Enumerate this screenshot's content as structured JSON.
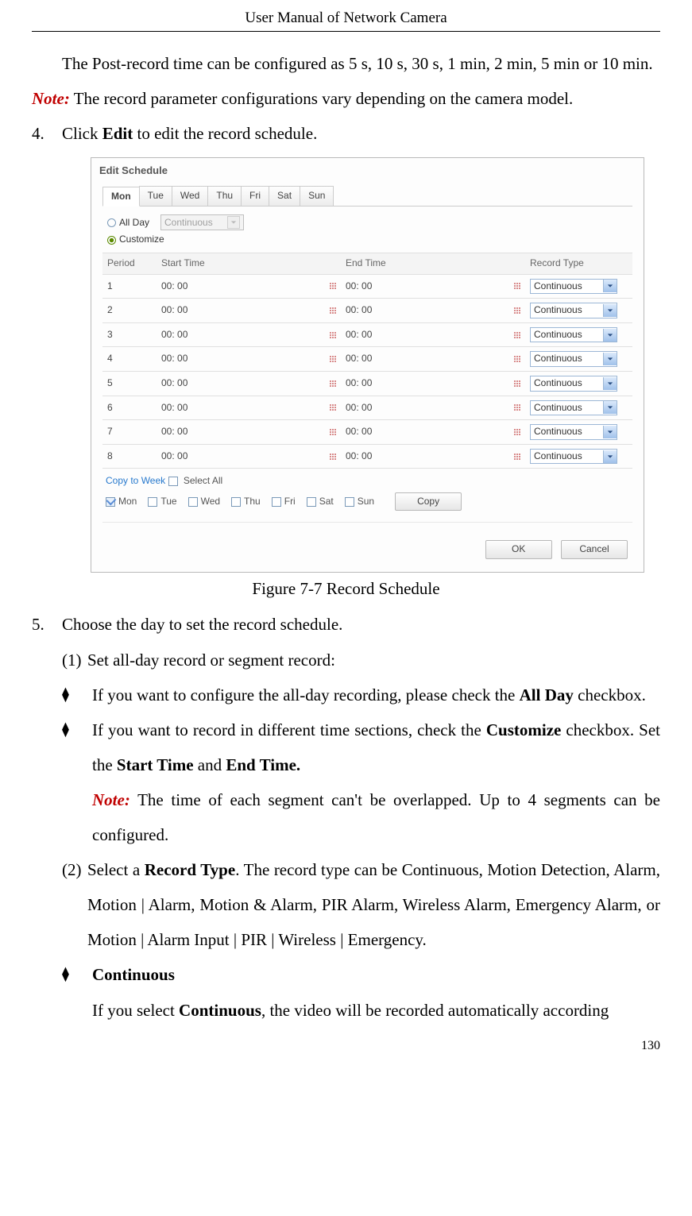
{
  "header": "User Manual of Network Camera",
  "page_number": "130",
  "para_postrecord": "The Post-record time can be configured as 5 s, 10 s, 30 s, 1 min, 2 min, 5 min or 10 min.",
  "note_label": "Note:",
  "note_text": " The record parameter configurations vary depending on the camera model.",
  "step4_num": "4.",
  "step4_a": "Click ",
  "step4_b": "Edit",
  "step4_c": " to edit the record schedule.",
  "fig_caption": "Figure 7-7 Record Schedule",
  "step5_num": "5.",
  "step5_text": "Choose the day to set the record schedule.",
  "s5_1_mark": "(1)",
  "s5_1_text": "Set all-day record or segment record:",
  "d1_a": "If you want to configure the all-day recording, please check the ",
  "d1_b": "All Day",
  "d1_c": " checkbox.",
  "d2_a": "If you want to record in different time sections, check the ",
  "d2_b": "Customize",
  "d2_c": " checkbox. Set the ",
  "d2_d": "Start Time",
  "d2_e": " and ",
  "d2_f": "End Time.",
  "d2_note_a": "Note:",
  "d2_note_b": " The time of each segment can't be overlapped. Up to 4 segments can be configured.",
  "s5_2_mark": "(2)",
  "s5_2_a": "Select a ",
  "s5_2_b": "Record Type",
  "s5_2_c": ". The record type can be Continuous, Motion Detection, Alarm, Motion | Alarm, Motion & Alarm, PIR Alarm, Wireless Alarm, Emergency Alarm, or Motion | Alarm Input | PIR | Wireless | Emergency.",
  "d3_label": "Continuous",
  "d3_a": "If you select ",
  "d3_b": "Continuous",
  "d3_c": ", the video will be recorded automatically according",
  "shot": {
    "title": "Edit Schedule",
    "tabs": [
      "Mon",
      "Tue",
      "Wed",
      "Thu",
      "Fri",
      "Sat",
      "Sun"
    ],
    "active_tab_index": 0,
    "radio_allday": "All Day",
    "radio_customize": "Customize",
    "allday_select": "Continuous",
    "th_period": "Period",
    "th_start": "Start Time",
    "th_end": "End Time",
    "th_type": "Record Type",
    "rows": [
      {
        "p": "1",
        "s": "00: 00",
        "e": "00: 00",
        "t": "Continuous"
      },
      {
        "p": "2",
        "s": "00: 00",
        "e": "00: 00",
        "t": "Continuous"
      },
      {
        "p": "3",
        "s": "00: 00",
        "e": "00: 00",
        "t": "Continuous"
      },
      {
        "p": "4",
        "s": "00: 00",
        "e": "00: 00",
        "t": "Continuous"
      },
      {
        "p": "5",
        "s": "00: 00",
        "e": "00: 00",
        "t": "Continuous"
      },
      {
        "p": "6",
        "s": "00: 00",
        "e": "00: 00",
        "t": "Continuous"
      },
      {
        "p": "7",
        "s": "00: 00",
        "e": "00: 00",
        "t": "Continuous"
      },
      {
        "p": "8",
        "s": "00: 00",
        "e": "00: 00",
        "t": "Continuous"
      }
    ],
    "copy_label": "Copy to Week",
    "select_all": "Select All",
    "days": [
      "Mon",
      "Tue",
      "Wed",
      "Thu",
      "Fri",
      "Sat",
      "Sun"
    ],
    "copy_btn": "Copy",
    "ok": "OK",
    "cancel": "Cancel"
  }
}
